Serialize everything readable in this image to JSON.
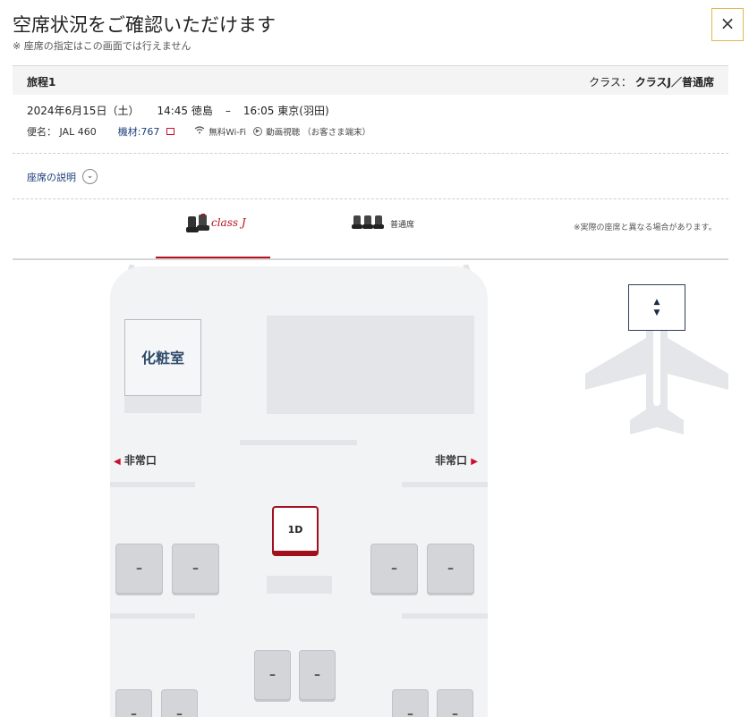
{
  "header": {
    "title": "空席状況をご確認いただけます",
    "subtitle": "※ 座席の指定はこの画面では行えません",
    "close_label": "×"
  },
  "itinerary": {
    "name": "旅程1",
    "class_prefix": "クラス：",
    "class_value": "クラスJ／普通席",
    "date": "2024年6月15日（土）",
    "departure": "14:45 徳島",
    "separator": "–",
    "arrival": "16:05 東京(羽田)",
    "flight": "便名： JAL 460",
    "aircraft": "機材:767",
    "wifi": "無料Wi-Fi",
    "video": "動画視聴 （お客さま端末）"
  },
  "seat_explanation": {
    "label": "座席の説明"
  },
  "tabs": [
    {
      "label": "class J",
      "active": true
    },
    {
      "label": "普通席",
      "active": false
    }
  ],
  "note": "※実際の座席と異なる場合があります。",
  "cabin": {
    "lavatory": "化粧室",
    "exit_left": "非常口",
    "exit_right": "非常口",
    "available_seat": "1D",
    "occupied_mark": "–"
  },
  "colors": {
    "accent": "#b5101c",
    "navy": "#1c3f7a"
  },
  "icons": [
    "close-icon",
    "chevron-down-icon",
    "external-link-icon",
    "wifi-icon",
    "play-icon",
    "arrow-left-icon",
    "arrow-right-icon",
    "airplane-icon",
    "updown-icon"
  ]
}
